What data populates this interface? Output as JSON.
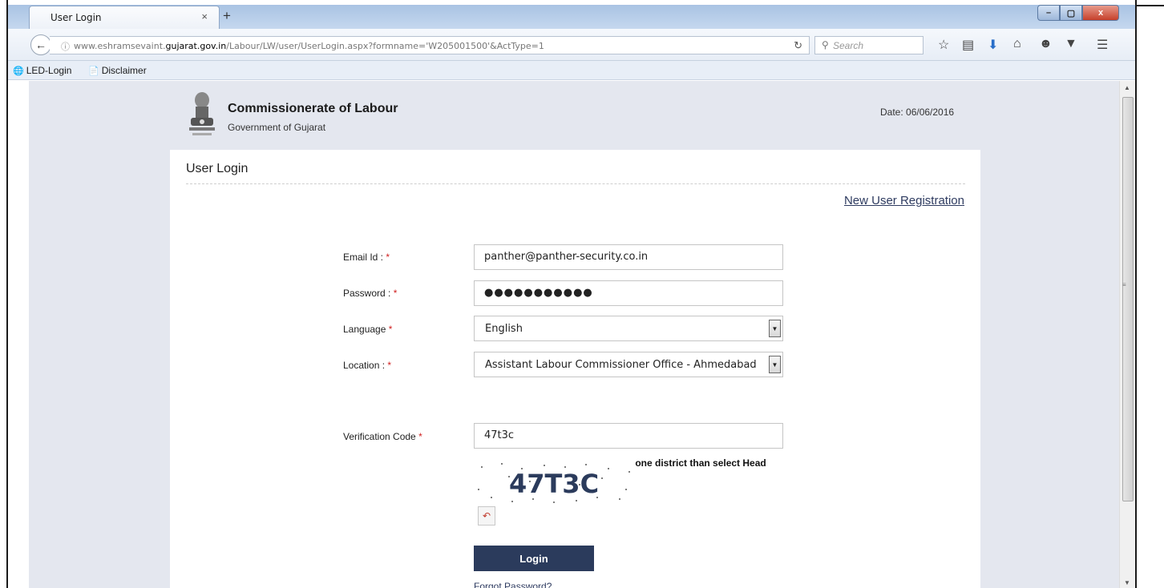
{
  "browser": {
    "tab_title": "User Login",
    "tab_close": "×",
    "new_tab": "+",
    "url_prefix": "www.eshramsevaint.",
    "url_domain": "gujarat.gov.in",
    "url_path": "/Labour/LW/user/UserLogin.aspx?formname='W205001500'&ActType=1",
    "search_placeholder": "Search",
    "window_min": "–",
    "window_max": "▢",
    "window_close": "x"
  },
  "bookmarks": [
    {
      "label": "LED-Login",
      "icon": "globe-icon"
    },
    {
      "label": "Disclaimer",
      "icon": "page-icon"
    }
  ],
  "header": {
    "org_name": "Commissionerate of Labour",
    "org_sub": "Government of Gujarat",
    "date": "Date: 06/06/2016"
  },
  "form": {
    "title": "User Login",
    "new_user_link": "New User Registration",
    "email_label": "Email Id : ",
    "email_value": "panther@panther-security.co.in",
    "password_label": "Password : ",
    "password_value": "●●●●●●●●●●●",
    "language_label": "Language ",
    "language_value": "English",
    "location_label": "Location : ",
    "location_value": "Assistant Labour Commissioner Office - Ahmedabad",
    "note": "Note : If aplication is for more than one district than select Head Office(Gandhinagar)",
    "verification_label": "Verification Code ",
    "verification_value": "47t3c",
    "captcha_text": "47T3C",
    "required_mark": "*",
    "login_button": "Login",
    "forgot_password": "Forgot Password?"
  },
  "colors": {
    "accent": "#2b3b5c",
    "link": "#2e3b60",
    "required": "#d02020",
    "page_bg": "#e4e7ef"
  }
}
